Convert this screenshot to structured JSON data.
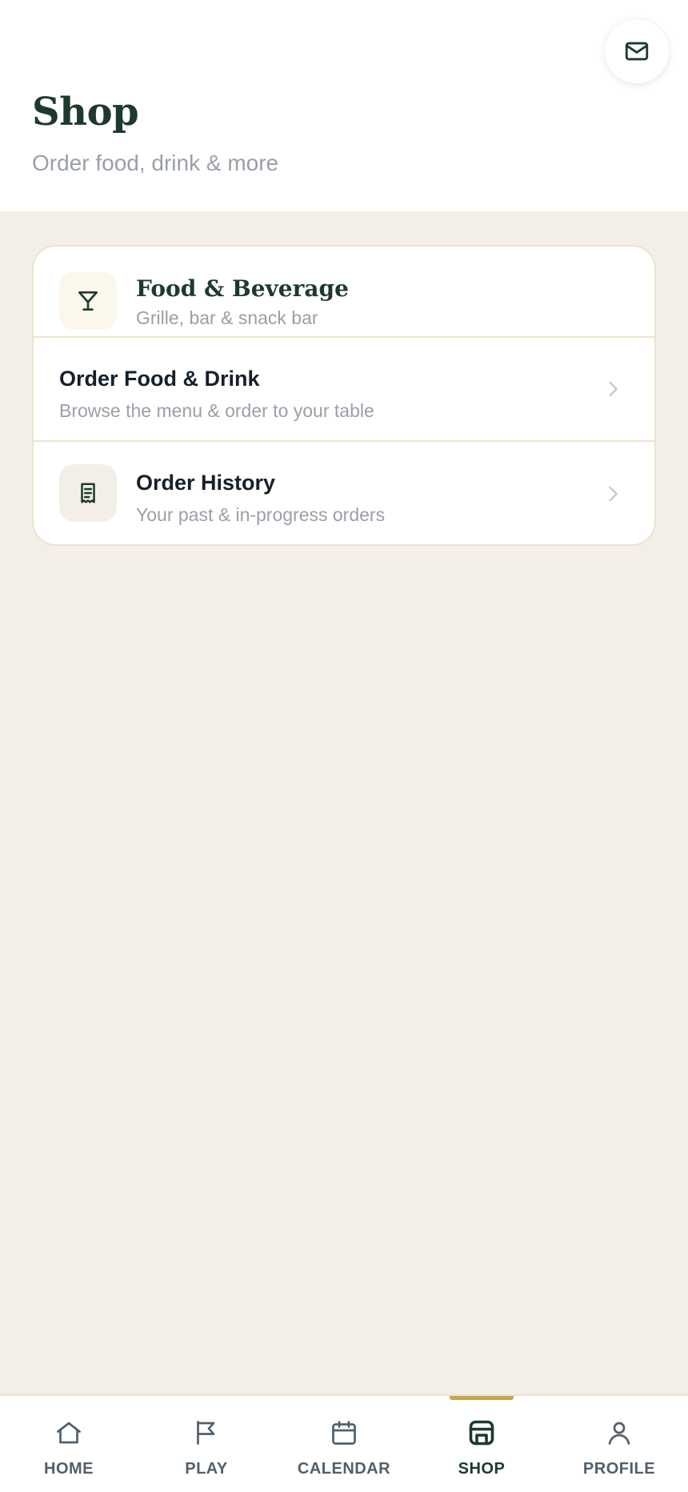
{
  "header": {
    "title": "Shop",
    "subtitle": "Order food, drink & more",
    "mail_icon": "mail-icon"
  },
  "section": {
    "title": "Food & Beverage",
    "subtitle": "Grille, bar & snack bar",
    "icon": "cocktail-glass-icon"
  },
  "items": [
    {
      "title": "Order Food & Drink",
      "subtitle": "Browse the menu & order to your table",
      "icon": "chevron-right-icon"
    },
    {
      "title": "Order History",
      "subtitle": "Your past & in-progress orders",
      "icon": "receipt-icon"
    }
  ],
  "tabbar": {
    "tabs": [
      {
        "label": "HOME",
        "icon": "home-icon"
      },
      {
        "label": "PLAY",
        "icon": "flag-icon"
      },
      {
        "label": "CALENDAR",
        "icon": "calendar-icon"
      },
      {
        "label": "SHOP",
        "icon": "shop-icon",
        "active": true
      },
      {
        "label": "PROFILE",
        "icon": "profile-icon"
      }
    ]
  },
  "colors": {
    "brand_green": "#1d3a2c",
    "accent_gold": "#c9a54f",
    "background": "#f3efe8",
    "muted_text": "#9aa0a8"
  }
}
